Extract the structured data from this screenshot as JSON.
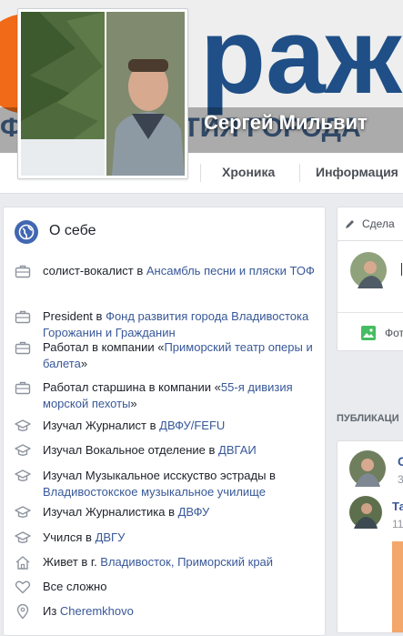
{
  "profile": {
    "name": "Сергей Мильвит"
  },
  "tabs": {
    "timeline": "Хроника",
    "info": "Информация"
  },
  "about": {
    "title": "О себе",
    "items": [
      {
        "icon": "briefcase-icon",
        "pre": "солист-вокалист в ",
        "link": "Ансамбль песни и пляски ТОФ",
        "post": ""
      },
      {
        "icon": "briefcase-icon",
        "pre": "President в ",
        "link": "Фонд развития города Владивостока Горожанин и Гражданин",
        "post": ""
      },
      {
        "icon": "briefcase-icon",
        "pre": "Работал в компании «",
        "link": "Приморский театр оперы и балета",
        "post": "»"
      },
      {
        "icon": "briefcase-icon",
        "pre": "Работал старшина в компании «",
        "link": "55-я дивизия морской пехоты",
        "post": "»"
      },
      {
        "icon": "graduation-cap-icon",
        "pre": "Изучал Журналист в ",
        "link": "ДВФУ/FEFU",
        "post": ""
      },
      {
        "icon": "graduation-cap-icon",
        "pre": "Изучал Вокальное отделение в ",
        "link": "ДВГАИ",
        "post": ""
      },
      {
        "icon": "graduation-cap-icon",
        "pre": "Изучал Музыкальное исскуство эстрады в ",
        "link": "Владивостокское музыкальное училище",
        "post": ""
      },
      {
        "icon": "graduation-cap-icon",
        "pre": "Изучал Журналистика в ",
        "link": "ДВФУ",
        "post": ""
      },
      {
        "icon": "graduation-cap-icon",
        "pre": "Учился в ",
        "link": "ДВГУ",
        "post": ""
      },
      {
        "icon": "home-icon",
        "pre": "Живет в г. ",
        "link": "Владивосток, Приморский край",
        "post": ""
      },
      {
        "icon": "heart-icon",
        "pre": "Все сложно",
        "link": "",
        "post": ""
      },
      {
        "icon": "location-pin-icon",
        "pre": "Из ",
        "link": "Cheremkhovo",
        "post": ""
      }
    ]
  },
  "right": {
    "create_post": "Сдела",
    "photo_button": "Фот",
    "publications_header": "ПУБЛИКАЦИ",
    "post1_name_initial": "С",
    "post1_time": "3",
    "post2_name": "Та",
    "post2_time": "11"
  },
  "colors": {
    "link": "#385898",
    "accent": "#4267b2",
    "page_bg": "#e9ebee"
  }
}
